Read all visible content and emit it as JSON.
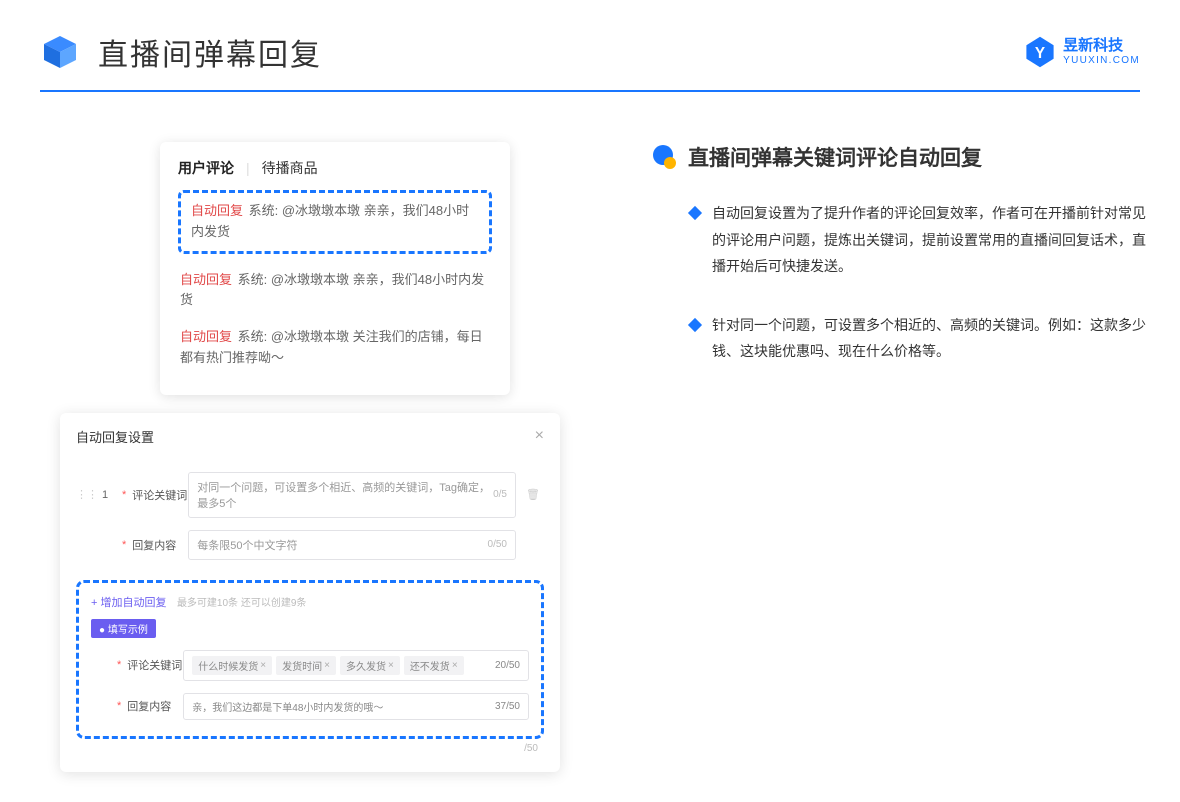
{
  "header": {
    "title": "直播间弹幕回复",
    "brand_cn": "昱新科技",
    "brand_en": "YUUXIN.COM"
  },
  "comments": {
    "tab_active": "用户评论",
    "tab_other": "待播商品",
    "highlighted": {
      "tag": "自动回复",
      "text": " 系统: @冰墩墩本墩 亲亲，我们48小时内发货"
    },
    "rows": [
      {
        "tag": "自动回复",
        "text": " 系统: @冰墩墩本墩 亲亲，我们48小时内发货"
      },
      {
        "tag": "自动回复",
        "text": " 系统: @冰墩墩本墩 关注我们的店铺，每日都有热门推荐呦～"
      }
    ]
  },
  "settings": {
    "title": "自动回复设置",
    "idx": "1",
    "label_keyword": "评论关键词",
    "placeholder_keyword": "对同一个问题，可设置多个相近、高频的关键词，Tag确定，最多5个",
    "counter_keyword": "0/5",
    "label_content": "回复内容",
    "placeholder_content": "每条限50个中文字符",
    "counter_content": "0/50",
    "add_link": "+ 增加自动回复",
    "add_muted": "最多可建10条 还可以创建9条",
    "example_badge": "● 填写示例",
    "ex_label_kw": "评论关键词",
    "ex_tags": [
      "什么时候发货",
      "发货时间",
      "多久发货",
      "还不发货"
    ],
    "ex_kw_counter": "20/50",
    "ex_label_ct": "回复内容",
    "ex_content": "亲，我们这边都是下单48小时内发货的哦～",
    "ex_ct_counter": "37/50",
    "trailing_counter": "/50"
  },
  "right": {
    "feature_title": "直播间弹幕关键词评论自动回复",
    "bullet1": "自动回复设置为了提升作者的评论回复效率，作者可在开播前针对常见的评论用户问题，提炼出关键词，提前设置常用的直播间回复话术，直播开始后可快捷发送。",
    "bullet2": "针对同一个问题，可设置多个相近的、高频的关键词。例如：这款多少钱、这块能优惠吗、现在什么价格等。"
  }
}
